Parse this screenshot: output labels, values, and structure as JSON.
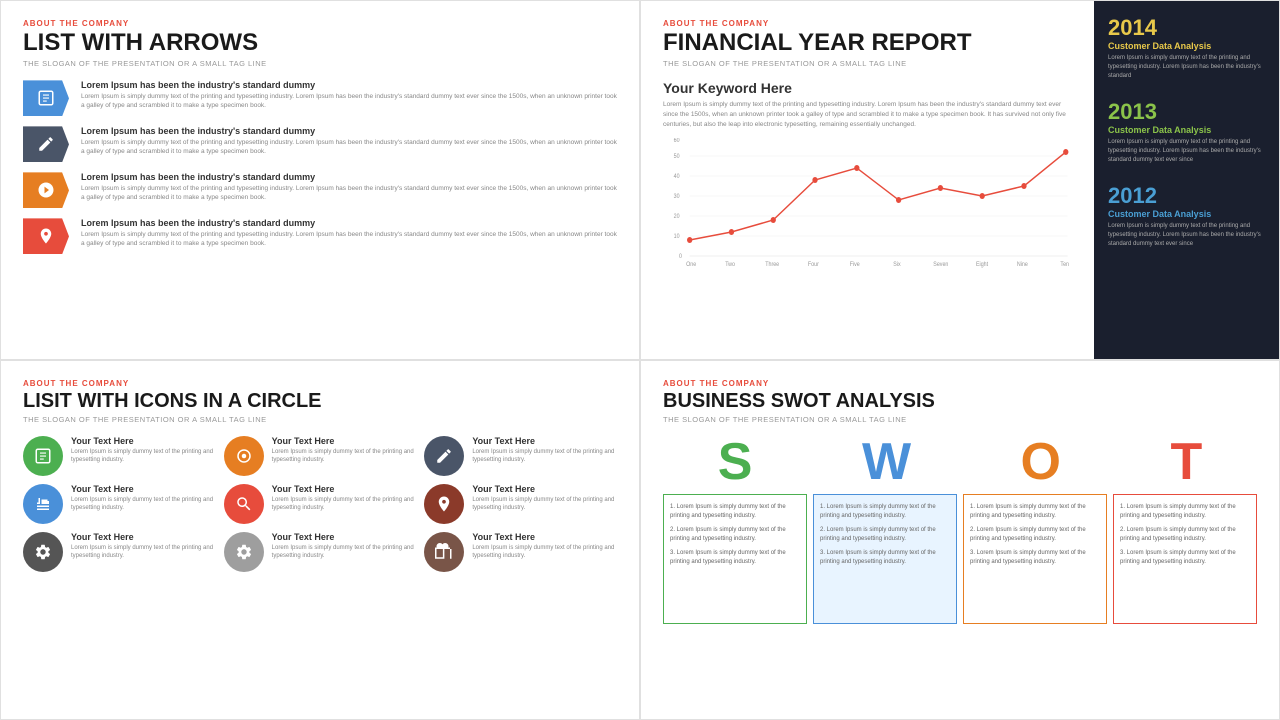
{
  "panel1": {
    "about": "About The Company",
    "title": "List With Arrows",
    "tagline": "The Slogan Of The Presentation Or A Small Tag Line",
    "items": [
      {
        "color": "blue",
        "heading": "Lorem Ipsum has been the industry's standard dummy",
        "text": "Lorem Ipsum is simply dummy text of the printing and typesetting industry. Lorem Ipsum has been the industry's standard dummy text ever since the 1500s, when an unknown printer took a galley of type and scrambled it to make a type specimen book."
      },
      {
        "color": "dark",
        "heading": "Lorem Ipsum has been the industry's standard dummy",
        "text": "Lorem Ipsum is simply dummy text of the printing and typesetting industry. Lorem Ipsum has been the industry's standard dummy text ever since the 1500s, when an unknown printer took a galley of type and scrambled it to make a type specimen book."
      },
      {
        "color": "orange",
        "heading": "Lorem Ipsum has been the industry's standard dummy",
        "text": "Lorem Ipsum is simply dummy text of the printing and typesetting industry. Lorem Ipsum has been the industry's standard dummy text ever since the 1500s, when an unknown printer took a galley of type and scrambled it to make a type specimen book."
      },
      {
        "color": "red",
        "heading": "Lorem Ipsum has been the industry's standard dummy",
        "text": "Lorem Ipsum is simply dummy text of the printing and typesetting industry. Lorem Ipsum has been the industry's standard dummy text ever since the 1500s, when an unknown printer took a galley of type and scrambled it to make a type specimen book."
      }
    ]
  },
  "panel2": {
    "about": "About The Company",
    "title": "Financial Year Report",
    "tagline": "The Slogan Of The Presentation Or A Small Tag Line",
    "keyword": "Your Keyword Here",
    "description": "Lorem Ipsum is simply dummy text of the printing and typesetting industry. Lorem Ipsum has been the industry's standard dummy text ever since the 1500s, when an unknown printer took a galley of type and scrambled it to make a type specimen book. It has survived not only five centuries, but also the leap into electronic typesetting, remaining essentially unchanged.",
    "chart": {
      "xLabels": [
        "One",
        "Two",
        "Three",
        "Four",
        "Five",
        "Six",
        "Seven",
        "Eight",
        "Nine",
        "Ten"
      ],
      "yLabels": [
        "0",
        "10",
        "20",
        "30",
        "40",
        "50",
        "60"
      ],
      "values": [
        8,
        12,
        18,
        38,
        44,
        28,
        34,
        30,
        35,
        52
      ]
    },
    "sidebar": [
      {
        "year": "2014",
        "class": "y2014",
        "titleLabel": "Customer Data Analysis",
        "text": "Lorem Ipsum is simply dummy text of the printing and typesetting industry. Lorem Ipsum has been the industry's standard"
      },
      {
        "year": "2013",
        "class": "y2013",
        "titleLabel": "Customer Data Analysis",
        "text": "Lorem Ipsum is simply dummy text of the printing and typesetting industry. Lorem Ipsum has been the industry's standard dummy text ever since"
      },
      {
        "year": "2012",
        "class": "y2012",
        "titleLabel": "Customer Data Analysis",
        "text": "Lorem Ipsum is simply dummy text of the printing and typesetting industry. Lorem Ipsum has been the industry's standard dummy text ever since"
      }
    ]
  },
  "panel3": {
    "about": "About The Company",
    "title": "Lisit With Icons In A Circle",
    "tagline": "The Slogan Of The Presentation Or A Small Tag Line",
    "items": [
      {
        "color": "ci-green",
        "heading": "Your Text Here",
        "text": "Lorem Ipsum is simply dummy text of the printing and typesetting industry."
      },
      {
        "color": "ci-orange",
        "heading": "Your Text Here",
        "text": "Lorem Ipsum is simply dummy text of the printing and typesetting industry."
      },
      {
        "color": "ci-dark",
        "heading": "Your Text Here",
        "text": "Lorem Ipsum is simply dummy text of the printing and typesetting industry."
      },
      {
        "color": "ci-blue",
        "heading": "Your Text Here",
        "text": "Lorem Ipsum is simply dummy text of the printing and typesetting industry."
      },
      {
        "color": "ci-red",
        "heading": "Your Text Here",
        "text": "Lorem Ipsum is simply dummy text of the printing and typesetting industry."
      },
      {
        "color": "ci-darkred",
        "heading": "Your Text Here",
        "text": "Lorem Ipsum is simply dummy text of the printing and typesetting industry."
      },
      {
        "color": "ci-darkgray",
        "heading": "Your Text Here",
        "text": "Lorem Ipsum is simply dummy text of the printing and typesetting industry."
      },
      {
        "color": "ci-lightgray",
        "heading": "Your Text Here",
        "text": "Lorem Ipsum is simply dummy text of the printing and typesetting industry."
      },
      {
        "color": "ci-brown",
        "heading": "Your Text Here",
        "text": "Lorem Ipsum is simply dummy text of the printing and typesetting industry."
      }
    ]
  },
  "panel4": {
    "about": "About The Company",
    "title": "Business SWOT Analysis",
    "tagline": "The Slogan Of The Presentation Or A Small Tag Line",
    "letters": [
      "S",
      "W",
      "O",
      "T"
    ],
    "boxes": [
      {
        "letter": "S",
        "points": [
          "Lorem Ipsum is simply dummy text of the printing and typesetting industry.",
          "Lorem Ipsum is simply dummy text of the printing and typesetting industry.",
          "Lorem Ipsum is simply dummy text of the printing and typesetting industry."
        ]
      },
      {
        "letter": "W",
        "points": [
          "Lorem Ipsum is simply dummy text of the printing and typesetting industry.",
          "Lorem Ipsum is simply dummy text of the printing and typesetting industry.",
          "Lorem Ipsum is simply dummy text of the printing and typesetting industry."
        ]
      },
      {
        "letter": "O",
        "points": [
          "Lorem Ipsum is simply dummy text of the printing and typesetting industry.",
          "Lorem Ipsum is simply dummy text of the printing and typesetting industry.",
          "Lorem Ipsum is simply dummy text of the printing and typesetting industry."
        ]
      },
      {
        "letter": "T",
        "points": [
          "Lorem Ipsum is simply dummy text of the printing and typesetting industry.",
          "Lorem Ipsum is simply dummy text of the printing and typesetting industry.",
          "Lorem Ipsum is simply dummy text of the printing and typesetting industry."
        ]
      }
    ]
  }
}
